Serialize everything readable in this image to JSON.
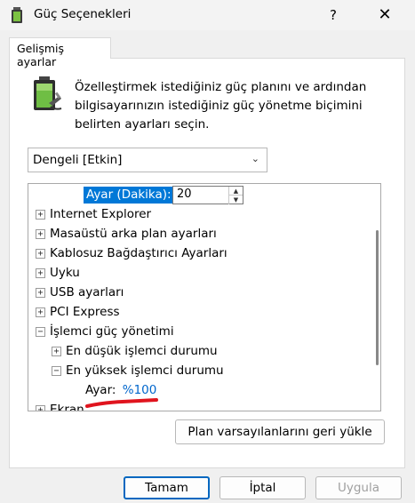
{
  "window": {
    "title": "Güç Seçenekleri",
    "help_label": "?",
    "close_label": "✕"
  },
  "tabs": [
    "Gelişmiş ayarlar"
  ],
  "description": "Özelleştirmek istediğiniz güç planını ve ardından bilgisayarınızın istediğiniz güç yönetme biçimini belirten ayarları seçin.",
  "plan_select": {
    "value": "Dengeli [Etkin]"
  },
  "tree": {
    "selected_setting": {
      "label": "Ayar (Dakika):",
      "value": "20"
    },
    "items": [
      {
        "label": "Internet Explorer",
        "expander": "+"
      },
      {
        "label": "Masaüstü arka plan ayarları",
        "expander": "+"
      },
      {
        "label": "Kablosuz Bağdaştırıcı Ayarları",
        "expander": "+"
      },
      {
        "label": "Uyku",
        "expander": "+"
      },
      {
        "label": "USB ayarları",
        "expander": "+"
      },
      {
        "label": "PCI Express",
        "expander": "+"
      },
      {
        "label": "İşlemci güç yönetimi",
        "expander": "−"
      },
      {
        "label": "En düşük işlemci durumu",
        "expander": "+"
      },
      {
        "label": "En yüksek işlemci durumu",
        "expander": "−"
      }
    ],
    "processor_max_setting": {
      "label": "Ayar:",
      "value": "%100"
    },
    "partial_item": {
      "label": "Ekran",
      "expander": "+"
    }
  },
  "buttons": {
    "restore": "Plan varsayılanlarını geri yükle",
    "ok": "Tamam",
    "cancel": "İptal",
    "apply": "Uygula"
  },
  "colors": {
    "selection": "#0078d7",
    "link_value": "#0066cc",
    "annotation": "#e0141e",
    "default_button_border": "#0067c0"
  },
  "icons": [
    "app-power-icon",
    "battery-plug-icon",
    "chevron-down-icon",
    "spin-up-icon",
    "spin-down-icon"
  ]
}
